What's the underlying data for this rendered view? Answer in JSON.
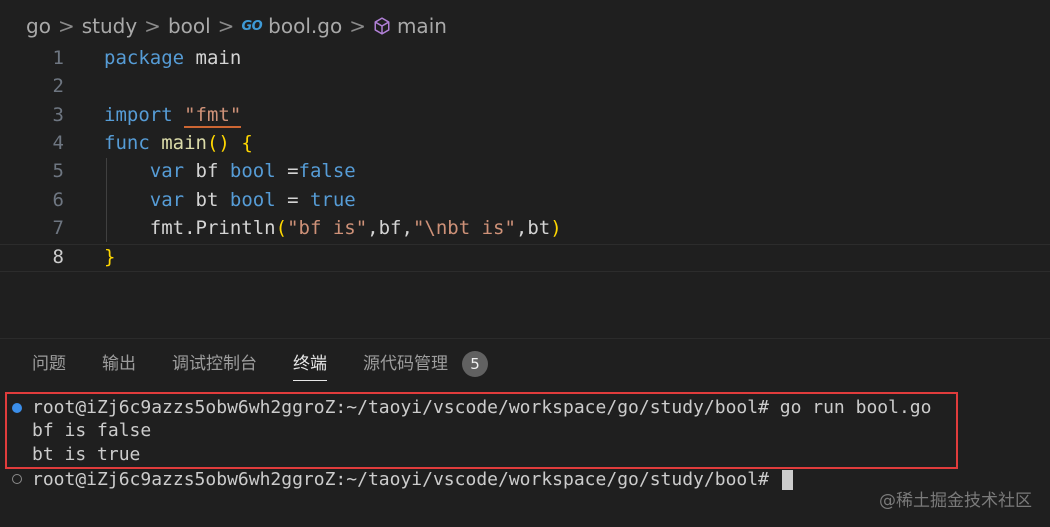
{
  "breadcrumb": {
    "items": [
      "go",
      "study",
      "bool"
    ],
    "file_icon_text": "GO",
    "file": "bool.go",
    "symbol": "main",
    "separator": ">"
  },
  "editor": {
    "line_numbers": [
      "1",
      "2",
      "3",
      "4",
      "5",
      "6",
      "7",
      "8"
    ],
    "active_line": "8",
    "lines": {
      "l1": {
        "kw": "package",
        "rest": " main"
      },
      "l3": {
        "kw": "import",
        "sp": " ",
        "str": "\"fmt\""
      },
      "l4": {
        "kw": "func",
        "sp": " ",
        "fn": "main",
        "paren": "()",
        "sp2": " ",
        "brace": "{"
      },
      "l5": {
        "indent": "    ",
        "kw": "var",
        "sp": " ",
        "name": "bf",
        "sp2": " ",
        "type": "bool",
        "op": " =",
        "val": "false"
      },
      "l6": {
        "indent": "    ",
        "kw": "var",
        "sp": " ",
        "name": "bt",
        "sp2": " ",
        "type": "bool",
        "op": " = ",
        "val": "true"
      },
      "l7": {
        "indent": "    ",
        "pkg": "fmt",
        "dot": ".",
        "fn": "Println",
        "lp": "(",
        "s1": "\"bf is\"",
        "c1": ",",
        "a1": "bf",
        "c2": ",",
        "s2": "\"\\nbt is\"",
        "c3": ",",
        "a2": "bt",
        "rp": ")"
      },
      "l8": {
        "brace": "}"
      }
    }
  },
  "panel": {
    "tabs": [
      "问题",
      "输出",
      "调试控制台",
      "终端",
      "源代码管理"
    ],
    "active_tab": "终端",
    "badge": "5"
  },
  "terminal": {
    "lines": [
      "root@iZj6c9azzs5obw6wh2ggroZ:~/taoyi/vscode/workspace/go/study/bool# go run bool.go",
      "bf is false",
      "bt is true",
      "root@iZj6c9azzs5obw6wh2ggroZ:~/taoyi/vscode/workspace/go/study/bool# "
    ]
  },
  "watermark": "@稀土掘金技术社区",
  "colors": {
    "background": "#1f1f1f",
    "keyword": "#569cd6",
    "string": "#ce9178",
    "function": "#dcdcaa",
    "highlight_border": "#e03c3c",
    "terminal_dot": "#3b8eea"
  }
}
